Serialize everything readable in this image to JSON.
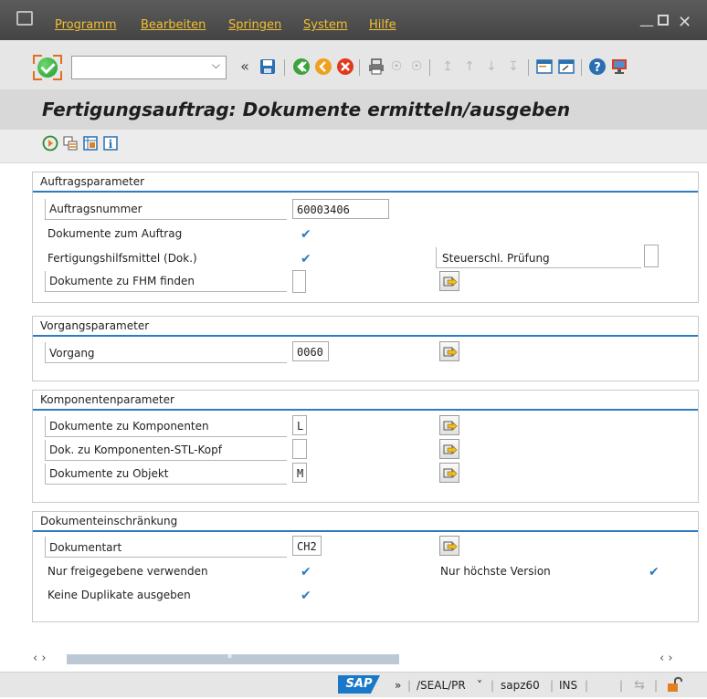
{
  "menu": {
    "items": [
      "Programm",
      "Bearbeiten",
      "Springen",
      "System",
      "Hilfe"
    ]
  },
  "toolbar": {
    "command_value": "",
    "nav_back_symbol": "«",
    "icons": [
      "save-icon",
      "back-icon",
      "exit-icon",
      "cancel-icon",
      "print-icon",
      "find-icon",
      "find-next-icon",
      "first-page-icon",
      "previous-page-icon",
      "next-page-icon",
      "last-page-icon",
      "create-session-icon",
      "shortcut-icon",
      "help-icon",
      "customize-layout-icon"
    ]
  },
  "title": "Fertigungsauftrag: Dokumente ermitteln/ausgeben",
  "app_toolbar": {
    "icons": [
      "execute-icon",
      "get-variant-icon",
      "selection-options-icon",
      "info-icon"
    ]
  },
  "sections": {
    "auftrag": {
      "title": "Auftragsparameter",
      "auftragsnummer_label": "Auftragsnummer",
      "auftragsnummer_value": "60003406",
      "dok_auftrag_label": "Dokumente zum Auftrag",
      "dok_auftrag_checked": true,
      "fhm_label": "Fertigungshilfsmittel (Dok.)",
      "fhm_checked": true,
      "steuerschl_label": "Steuerschl. Prüfung",
      "steuerschl_value": "",
      "dok_fhm_label": "Dokumente zu FHM finden",
      "dok_fhm_value": ""
    },
    "vorgang": {
      "title": "Vorgangsparameter",
      "vorgang_label": "Vorgang",
      "vorgang_value": "0060"
    },
    "komponenten": {
      "title": "Komponentenparameter",
      "komp_label": "Dokumente zu Komponenten",
      "komp_value": "L",
      "stl_label": "Dok. zu Komponenten-STL-Kopf",
      "stl_value": "",
      "objekt_label": "Dokumente zu Objekt",
      "objekt_value": "M"
    },
    "einschraenkung": {
      "title": "Dokumenteinschränkung",
      "dokart_label": "Dokumentart",
      "dokart_value": "CH2",
      "freigegeben_label": "Nur freigegebene verwenden",
      "freigegeben_checked": true,
      "hoechste_label": "Nur höchste Version",
      "hoechste_checked": true,
      "duplikate_label": "Keine Duplikate ausgeben",
      "duplikate_checked": true
    }
  },
  "scrollbar": {
    "left": "‹ ›",
    "right": "‹ ›",
    "thumb_grip": "III"
  },
  "status": {
    "logo": "SAP",
    "expand": "»",
    "program": "/SEAL/PR",
    "program_dropdown": "˅",
    "system": "sapz60",
    "mode": "INS"
  },
  "colors": {
    "accent_blue": "#2e7bbf",
    "menu_text": "#f0c030",
    "enter_green": "#1e9a2e"
  }
}
